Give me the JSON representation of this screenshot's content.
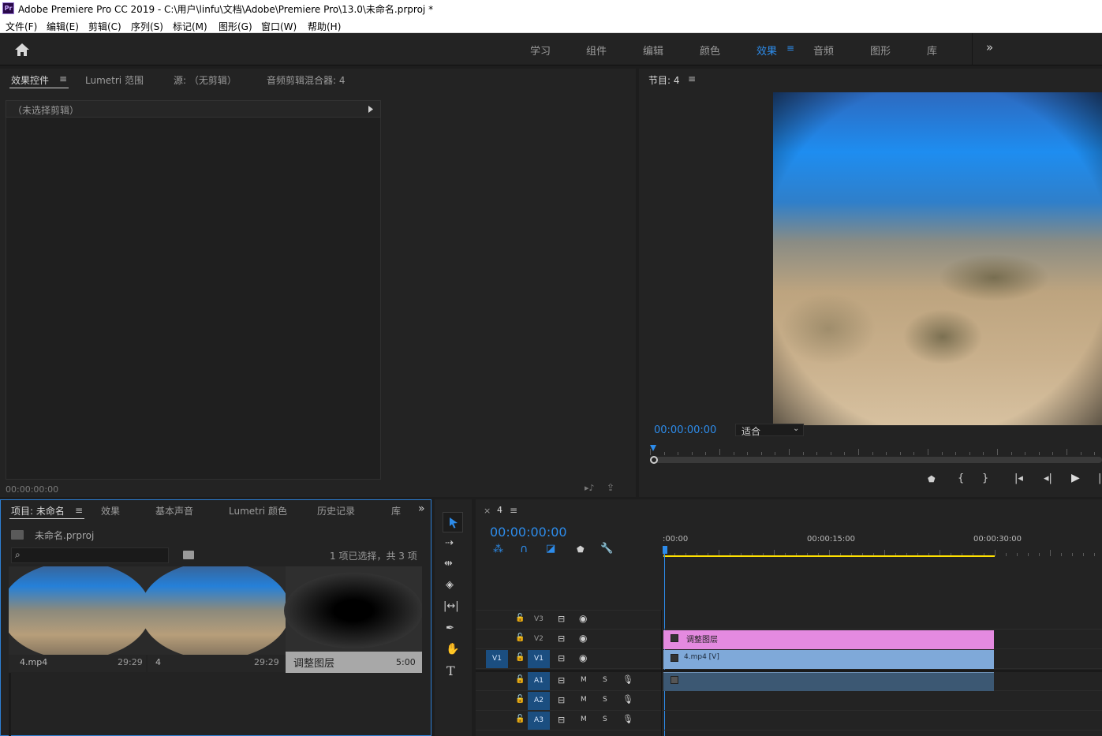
{
  "window": {
    "app_icon": "Pr",
    "title": "Adobe Premiere Pro CC 2019 - C:\\用户\\linfu\\文档\\Adobe\\Premiere Pro\\13.0\\未命名.prproj *"
  },
  "menu": {
    "items": [
      "文件(F)",
      "编辑(E)",
      "剪辑(C)",
      "序列(S)",
      "标记(M)",
      "图形(G)",
      "窗口(W)",
      "帮助(H)"
    ]
  },
  "workspaces": {
    "items": [
      "学习",
      "组件",
      "编辑",
      "颜色",
      "效果",
      "音频",
      "图形",
      "库"
    ],
    "active": "效果",
    "overflow": "»"
  },
  "effect_controls": {
    "tabs": [
      "效果控件",
      "Lumetri 范围",
      "源: （无剪辑）",
      "音频剪辑混合器: 4"
    ],
    "no_clip": "（未选择剪辑）",
    "timecode": "00:00:00:00"
  },
  "program": {
    "title": "节目: 4",
    "timecode": "00:00:00:00",
    "fit": "适合"
  },
  "project": {
    "tabs": [
      "项目: 未命名",
      "效果",
      "基本声音",
      "Lumetri 颜色",
      "历史记录",
      "库"
    ],
    "overflow": "»",
    "filename": "未命名.prproj",
    "search_placeholder": "",
    "selection": "1 项已选择，共 3 项",
    "items": [
      {
        "name": "4.mp4",
        "duration": "29:29"
      },
      {
        "name": "4",
        "duration": "29:29"
      },
      {
        "name": "调整图层",
        "duration": "5:00"
      }
    ]
  },
  "timeline": {
    "tab": "4",
    "close": "×",
    "timecode": "00:00:00:00",
    "ruler": [
      ":00:00",
      "00:00:15:00",
      "00:00:30:00"
    ],
    "tracks_video": [
      "V3",
      "V2",
      "V1"
    ],
    "tracks_audio": [
      "A1",
      "A2",
      "A3"
    ],
    "source_patch_v": "V1",
    "clips": [
      {
        "name": "调整图层",
        "track": "V2",
        "color": "#e48ae0"
      },
      {
        "name": "4.mp4 [V]",
        "track": "V1",
        "color": "#7fa9d9"
      }
    ],
    "mute": "M",
    "solo": "S"
  },
  "colors": {
    "accent": "#2d8ceb",
    "playhead": "#2d8ceb",
    "adjustment_clip": "#e48ae0",
    "video_clip": "#7fa9d9",
    "audio_clip": "#3c5873",
    "work_area": "#ffe100"
  }
}
